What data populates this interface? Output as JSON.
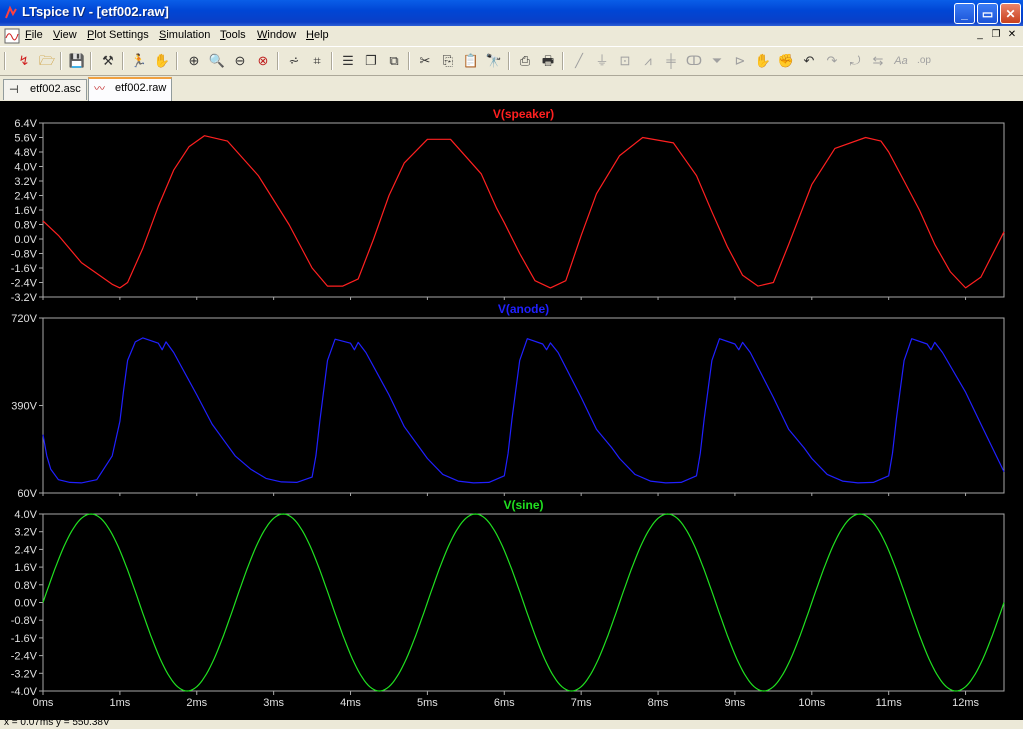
{
  "window": {
    "title": "LTspice IV - [etf002.raw]"
  },
  "menu": {
    "items": [
      {
        "label": "File",
        "u": "F",
        "rest": "ile"
      },
      {
        "label": "View",
        "u": "V",
        "rest": "iew"
      },
      {
        "label": "Plot Settings",
        "u": "P",
        "rest": "lot Settings"
      },
      {
        "label": "Simulation",
        "u": "S",
        "rest": "imulation"
      },
      {
        "label": "Tools",
        "u": "T",
        "rest": "ools"
      },
      {
        "label": "Window",
        "u": "W",
        "rest": "indow"
      },
      {
        "label": "Help",
        "u": "H",
        "rest": "elp"
      }
    ]
  },
  "tabs": [
    {
      "label": "etf002.asc",
      "icon": "schematic-icon"
    },
    {
      "label": "etf002.raw",
      "icon": "waveform-icon"
    }
  ],
  "status": {
    "text": "x = 0.07ms   y = 550.38V"
  },
  "colors": {
    "plot_bg": "#000000",
    "frame": "#a8a8a8",
    "speaker": "#ff2020",
    "anode": "#2020ff",
    "sine": "#20e020"
  },
  "chart_data": [
    {
      "type": "line",
      "title": "V(speaker)",
      "xlim": [
        0,
        12.5
      ],
      "ylim": [
        -3.2,
        6.4
      ],
      "yticks": [
        "6.4V",
        "5.6V",
        "4.8V",
        "4.0V",
        "3.2V",
        "2.4V",
        "1.6V",
        "0.8V",
        "0.0V",
        "-0.8V",
        "-1.6V",
        "-2.4V",
        "-3.2V"
      ],
      "series": [
        {
          "name": "V(speaker)",
          "x": [
            0,
            0.2,
            0.5,
            0.9,
            1.0,
            1.1,
            1.3,
            1.5,
            1.7,
            1.9,
            2.1,
            2.4,
            2.8,
            3.2,
            3.4,
            3.5,
            3.7,
            3.9,
            4.1,
            4.3,
            4.5,
            4.7,
            5.0,
            5.3,
            5.7,
            5.9,
            6.0,
            6.2,
            6.4,
            6.6,
            6.8,
            7.0,
            7.2,
            7.5,
            7.8,
            8.2,
            8.4,
            8.5,
            8.7,
            8.9,
            9.1,
            9.3,
            9.5,
            9.7,
            10.0,
            10.3,
            10.7,
            10.9,
            11.0,
            11.2,
            11.4,
            11.6,
            11.8,
            12.0,
            12.2,
            12.5
          ],
          "y": [
            1.0,
            0.2,
            -1.3,
            -2.5,
            -2.7,
            -2.4,
            -0.5,
            1.8,
            3.8,
            5.1,
            5.7,
            5.4,
            3.5,
            0.8,
            -0.8,
            -1.6,
            -2.6,
            -2.6,
            -2.2,
            0.0,
            2.4,
            4.2,
            5.5,
            5.5,
            3.6,
            1.7,
            0.9,
            -0.8,
            -2.3,
            -2.7,
            -2.3,
            0.2,
            2.5,
            4.6,
            5.6,
            5.3,
            4.1,
            3.5,
            1.5,
            -0.4,
            -2.0,
            -2.6,
            -2.4,
            -0.3,
            3.0,
            5.0,
            5.6,
            5.4,
            4.8,
            3.2,
            1.6,
            -0.3,
            -1.8,
            -2.7,
            -2.1,
            0.4
          ]
        }
      ]
    },
    {
      "type": "line",
      "title": "V(anode)",
      "xlim": [
        0,
        12.5
      ],
      "ylim": [
        60,
        720
      ],
      "yticks": [
        "720V",
        "390V",
        "60V"
      ],
      "series": [
        {
          "name": "V(anode)",
          "x": [
            0,
            0.05,
            0.1,
            0.2,
            0.35,
            0.5,
            0.7,
            0.9,
            1.0,
            1.05,
            1.1,
            1.2,
            1.3,
            1.5,
            1.55,
            1.6,
            1.7,
            2.0,
            2.2,
            2.4,
            2.5,
            2.7,
            2.9,
            3.1,
            3.3,
            3.5,
            3.55,
            3.6,
            3.7,
            3.8,
            4.0,
            4.05,
            4.1,
            4.2,
            4.5,
            4.7,
            4.9,
            5.0,
            5.2,
            5.4,
            5.6,
            5.8,
            6.0,
            6.05,
            6.1,
            6.2,
            6.3,
            6.5,
            6.55,
            6.6,
            6.7,
            7.0,
            7.2,
            7.4,
            7.5,
            7.7,
            7.9,
            8.1,
            8.3,
            8.5,
            8.55,
            8.6,
            8.7,
            8.8,
            9.0,
            9.05,
            9.1,
            9.2,
            9.5,
            9.7,
            9.9,
            10.0,
            10.2,
            10.4,
            10.6,
            10.8,
            11.0,
            11.05,
            11.1,
            11.2,
            11.3,
            11.5,
            11.55,
            11.6,
            11.7,
            12.0,
            12.2,
            12.4,
            12.5
          ],
          "y": [
            280,
            200,
            150,
            110,
            100,
            98,
            110,
            200,
            330,
            450,
            560,
            630,
            645,
            625,
            600,
            630,
            590,
            430,
            320,
            240,
            200,
            150,
            115,
            102,
            100,
            120,
            200,
            330,
            560,
            640,
            625,
            600,
            628,
            590,
            430,
            310,
            230,
            190,
            130,
            105,
            98,
            100,
            125,
            210,
            340,
            560,
            642,
            622,
            600,
            626,
            590,
            420,
            300,
            230,
            190,
            130,
            105,
            98,
            100,
            125,
            210,
            340,
            560,
            642,
            622,
            600,
            628,
            590,
            420,
            300,
            230,
            190,
            130,
            105,
            98,
            100,
            125,
            210,
            340,
            560,
            642,
            622,
            600,
            628,
            590,
            440,
            320,
            200,
            140
          ]
        }
      ]
    },
    {
      "type": "line",
      "title": "V(sine)",
      "xlim": [
        0,
        12.5
      ],
      "ylim": [
        -4.0,
        4.0
      ],
      "amplitude": 4.0,
      "period_ms": 2.5,
      "xticks": [
        "0ms",
        "1ms",
        "2ms",
        "3ms",
        "4ms",
        "5ms",
        "6ms",
        "7ms",
        "8ms",
        "9ms",
        "10ms",
        "11ms",
        "12ms"
      ],
      "yticks": [
        "4.0V",
        "3.2V",
        "2.4V",
        "1.6V",
        "0.8V",
        "0.0V",
        "-0.8V",
        "-1.6V",
        "-2.4V",
        "-3.2V",
        "-4.0V"
      ],
      "series": [
        {
          "name": "V(sine)"
        }
      ]
    }
  ]
}
